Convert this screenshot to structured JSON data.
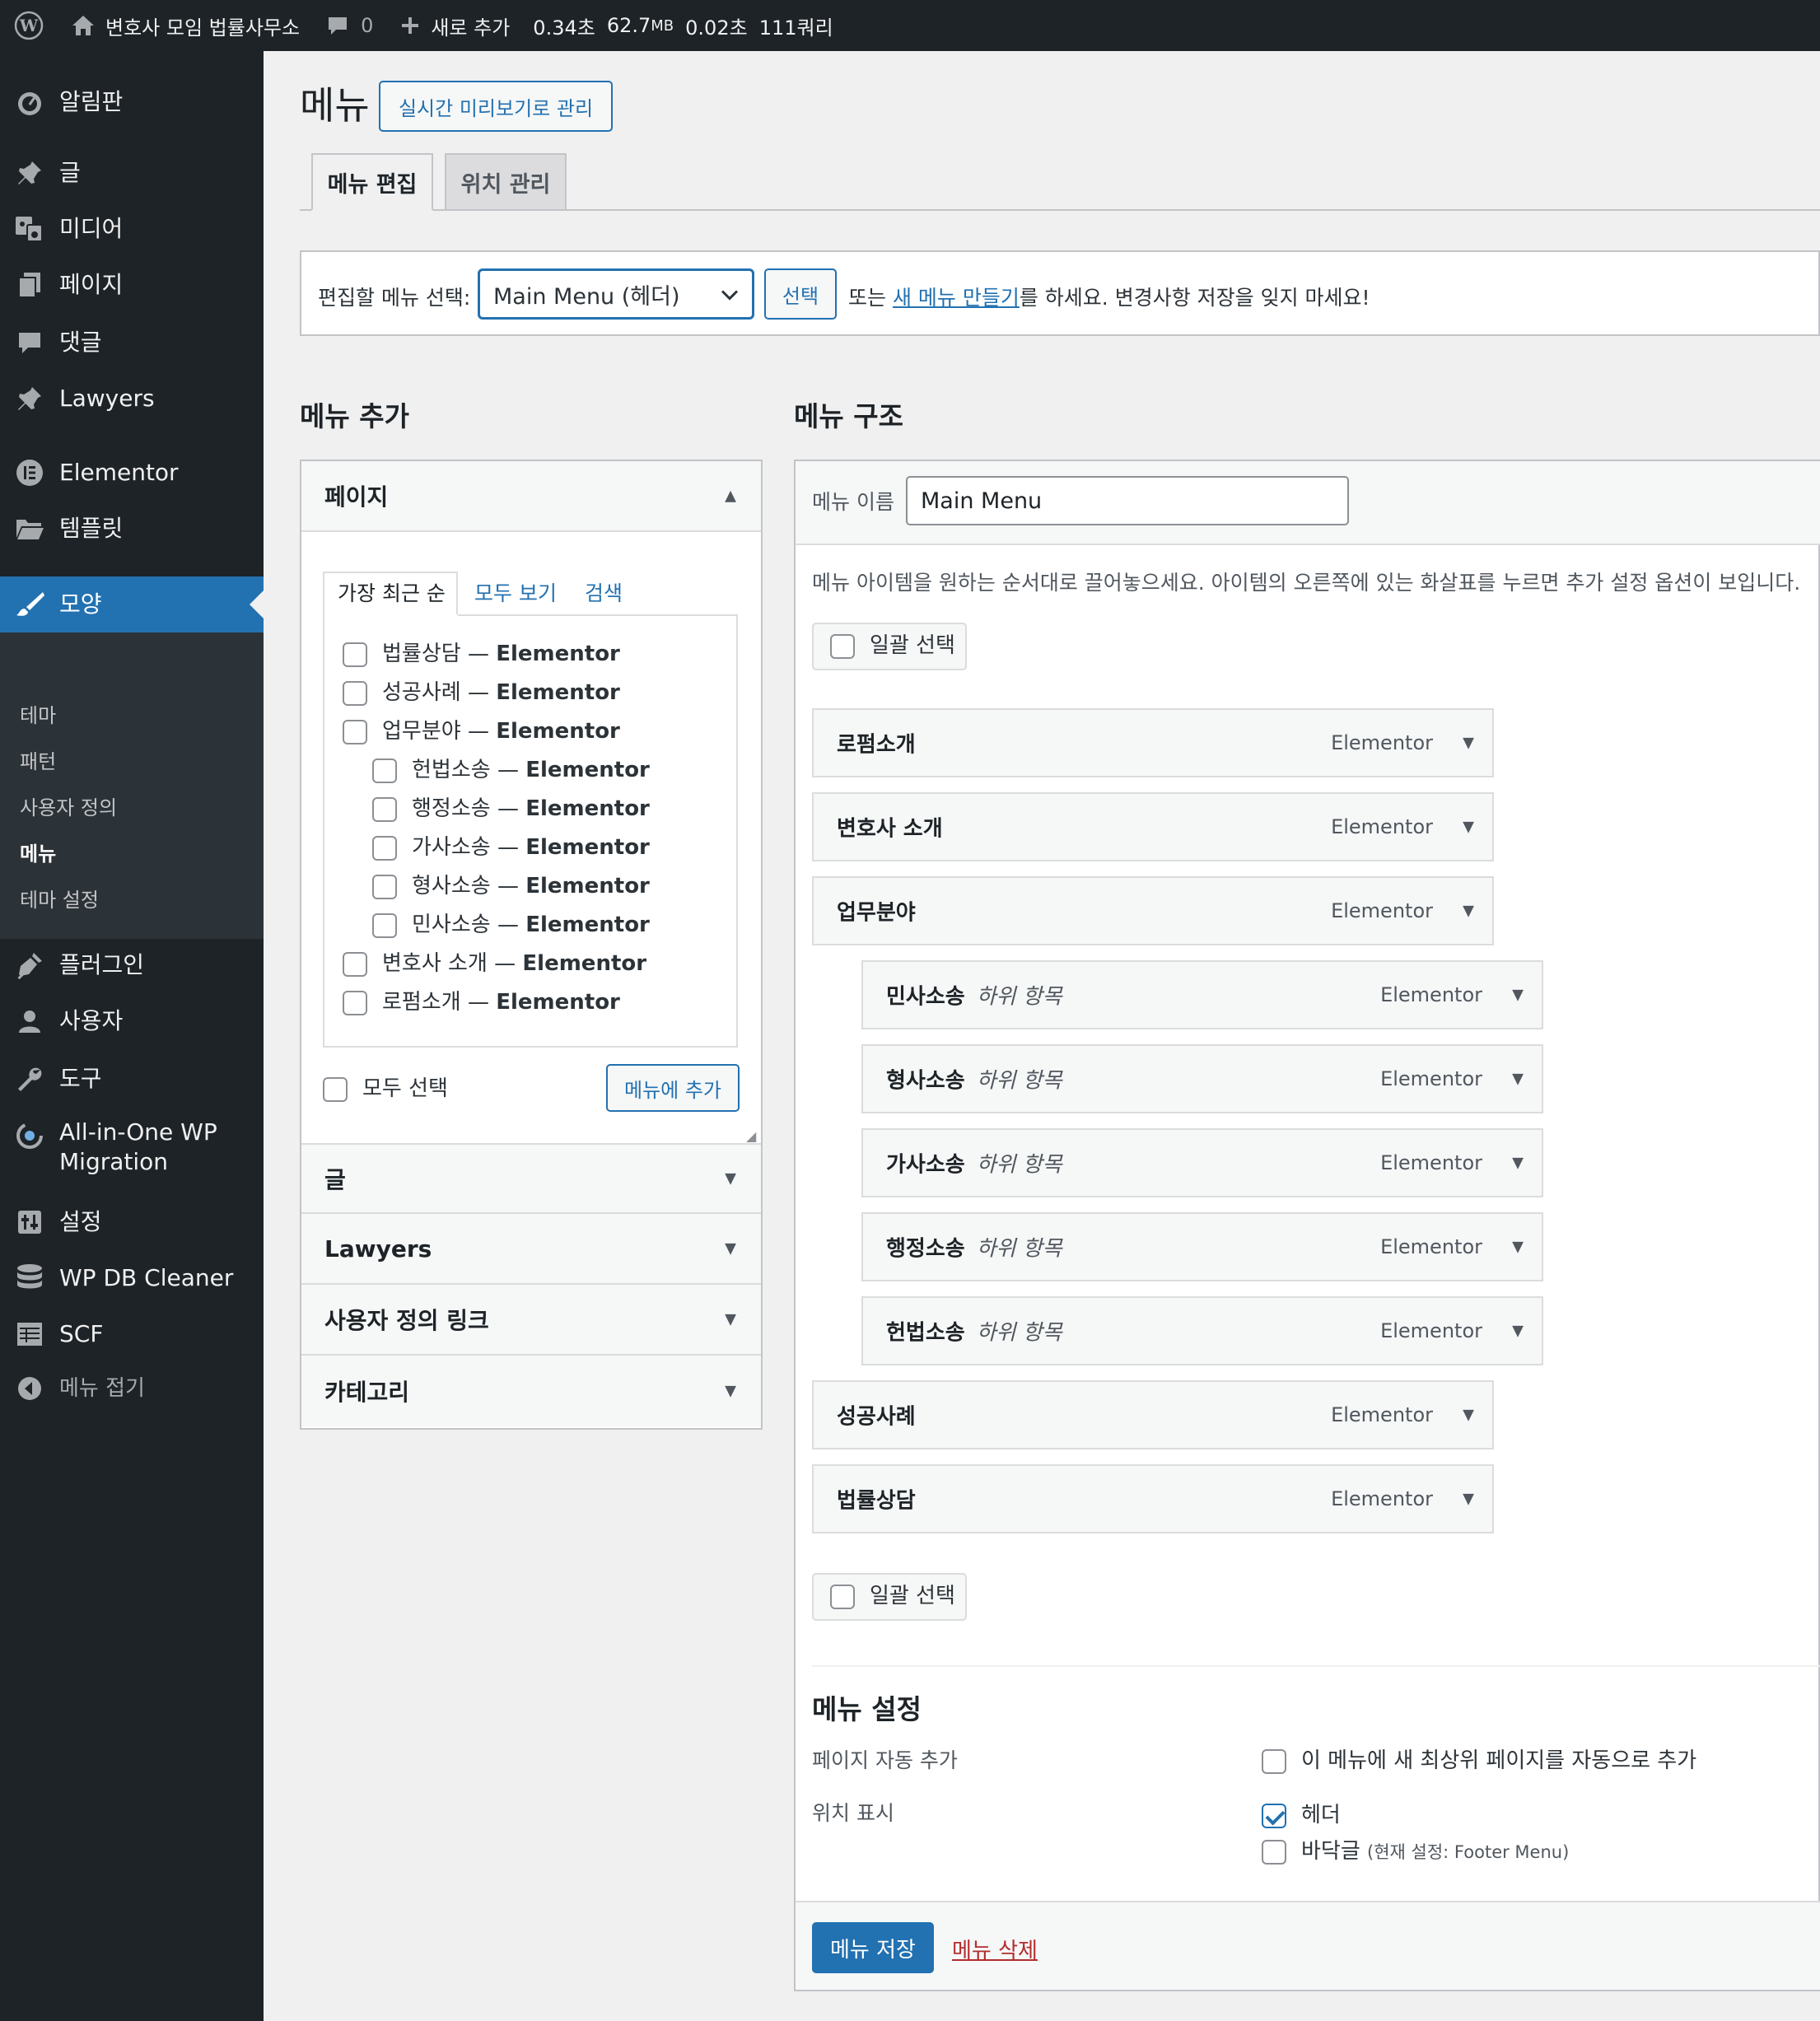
{
  "adminbar": {
    "site_name": "변호사 모임 법률사무소",
    "comments_count": "0",
    "new_label": "새로 추가",
    "qm_time": "0.34초",
    "qm_memory": "62.7",
    "qm_memory_unit": "MB",
    "qm_db_time": "0.02초",
    "qm_queries": "111쿼리"
  },
  "sidebar": {
    "items": [
      {
        "label": "알림판",
        "icon": "dashboard-icon"
      },
      {
        "label": "글",
        "icon": "pin-icon"
      },
      {
        "label": "미디어",
        "icon": "media-icon"
      },
      {
        "label": "페이지",
        "icon": "page-icon"
      },
      {
        "label": "댓글",
        "icon": "comment-icon"
      },
      {
        "label": "Lawyers",
        "icon": "pin-icon"
      },
      {
        "label": "Elementor",
        "icon": "elementor-icon"
      },
      {
        "label": "템플릿",
        "icon": "folder-icon"
      },
      {
        "label": "모양",
        "icon": "brush-icon"
      },
      {
        "label": "플러그인",
        "icon": "plugin-icon"
      },
      {
        "label": "사용자",
        "icon": "user-icon"
      },
      {
        "label": "도구",
        "icon": "wrench-icon"
      },
      {
        "label": "All-in-One WP",
        "label2": "Migration",
        "icon": "migration-icon"
      },
      {
        "label": "설정",
        "icon": "settings-icon"
      },
      {
        "label": "WP DB Cleaner",
        "icon": "database-icon"
      },
      {
        "label": "SCF",
        "icon": "table-icon"
      },
      {
        "label": "메뉴 접기",
        "icon": "collapse-icon"
      }
    ],
    "submenu": [
      "테마",
      "패턴",
      "사용자 정의",
      "메뉴",
      "테마 설정"
    ]
  },
  "page": {
    "title": "메뉴",
    "live_preview_button": "실시간 미리보기로 관리",
    "tabs": [
      "메뉴 편집",
      "위치 관리"
    ]
  },
  "manage": {
    "label": "편집할 메뉴 선택:",
    "selected_menu": "Main Menu (헤더)",
    "select_button": "선택",
    "text_before": "또는 ",
    "create_link": "새 메뉴 만들기",
    "text_after": "를 하세요. 변경사항 저장을 잊지 마세요!"
  },
  "add_menu": {
    "heading": "메뉴 추가",
    "pages_title": "페이지",
    "tabs": [
      "가장 최근 순",
      "모두 보기",
      "검색"
    ],
    "page_items": [
      {
        "name": "법률상담",
        "suffix": "Elementor",
        "child": false
      },
      {
        "name": "성공사례",
        "suffix": "Elementor",
        "child": false
      },
      {
        "name": "업무분야",
        "suffix": "Elementor",
        "child": false
      },
      {
        "name": "헌법소송",
        "suffix": "Elementor",
        "child": true
      },
      {
        "name": "행정소송",
        "suffix": "Elementor",
        "child": true
      },
      {
        "name": "가사소송",
        "suffix": "Elementor",
        "child": true
      },
      {
        "name": "형사소송",
        "suffix": "Elementor",
        "child": true
      },
      {
        "name": "민사소송",
        "suffix": "Elementor",
        "child": true
      },
      {
        "name": "변호사 소개",
        "suffix": "Elementor",
        "child": false
      },
      {
        "name": "로펌소개",
        "suffix": "Elementor",
        "child": false
      }
    ],
    "dash": " — ",
    "select_all": "모두 선택",
    "add_button": "메뉴에 추가",
    "other_sections": [
      "글",
      "Lawyers",
      "사용자 정의 링크",
      "카테고리"
    ]
  },
  "structure": {
    "heading": "메뉴 구조",
    "menu_name_label": "메뉴 이름",
    "menu_name_value": "Main Menu",
    "instructions": "메뉴 아이템을 원하는 순서대로 끌어놓으세요. 아이템의 오른쪽에 있는 화살표를 누르면 추가 설정 옵션이 보입니다.",
    "bulk_select": "일괄 선택",
    "items": [
      {
        "title": "로펌소개",
        "sub": "",
        "type": "Elementor",
        "depth": 0
      },
      {
        "title": "변호사 소개",
        "sub": "",
        "type": "Elementor",
        "depth": 0
      },
      {
        "title": "업무분야",
        "sub": "",
        "type": "Elementor",
        "depth": 0
      },
      {
        "title": "민사소송",
        "sub": "하위 항목",
        "type": "Elementor",
        "depth": 1
      },
      {
        "title": "형사소송",
        "sub": "하위 항목",
        "type": "Elementor",
        "depth": 1
      },
      {
        "title": "가사소송",
        "sub": "하위 항목",
        "type": "Elementor",
        "depth": 1
      },
      {
        "title": "행정소송",
        "sub": "하위 항목",
        "type": "Elementor",
        "depth": 1
      },
      {
        "title": "헌법소송",
        "sub": "하위 항목",
        "type": "Elementor",
        "depth": 1
      },
      {
        "title": "성공사례",
        "sub": "",
        "type": "Elementor",
        "depth": 0
      },
      {
        "title": "법률상담",
        "sub": "",
        "type": "Elementor",
        "depth": 0
      }
    ]
  },
  "settings": {
    "heading": "메뉴 설정",
    "auto_add_label": "페이지 자동 추가",
    "auto_add_option": "이 메뉴에 새 최상위 페이지를 자동으로 추가",
    "auto_add_checked": false,
    "location_label": "위치 표시",
    "location_header": "헤더",
    "location_header_checked": true,
    "location_footer": "바닥글",
    "location_footer_note": "(현재 설정: Footer Menu)",
    "location_footer_checked": false
  },
  "footer": {
    "save_button": "메뉴 저장",
    "delete_link": "메뉴 삭제"
  },
  "colors": {
    "accent": "#2271b1",
    "adminbar_bg": "#1d2327",
    "delete": "#b32d2e"
  }
}
